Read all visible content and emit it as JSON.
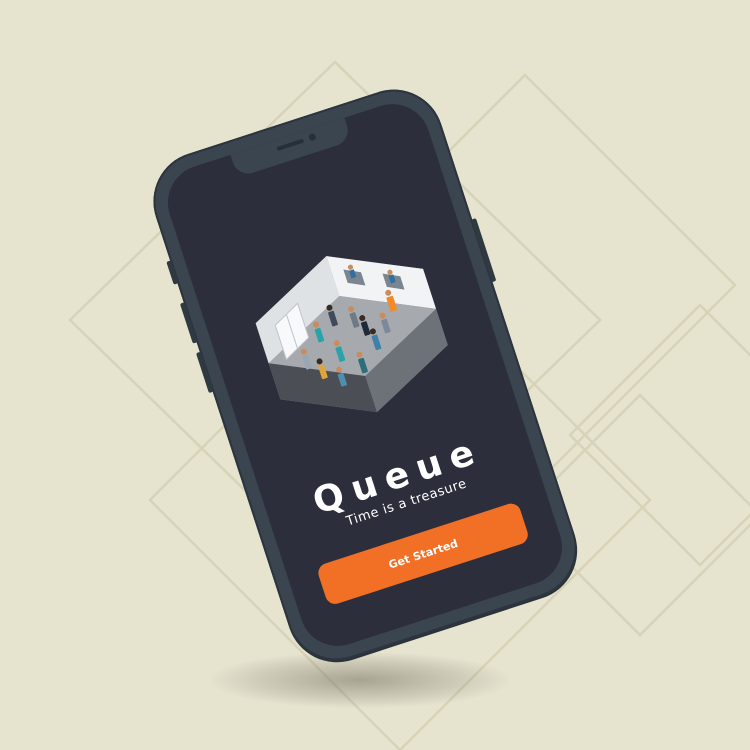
{
  "app": {
    "name": "Queue",
    "tagline": "Time is a treasure"
  },
  "cta": {
    "label": "Get Started"
  },
  "colors": {
    "background": "#e6e3cf",
    "phone_frame": "#3a4550",
    "screen": "#2c2f3b",
    "accent": "#f26f26",
    "text": "#ffffff"
  },
  "icons": {
    "illustration": "waiting-room-illustration-icon"
  }
}
